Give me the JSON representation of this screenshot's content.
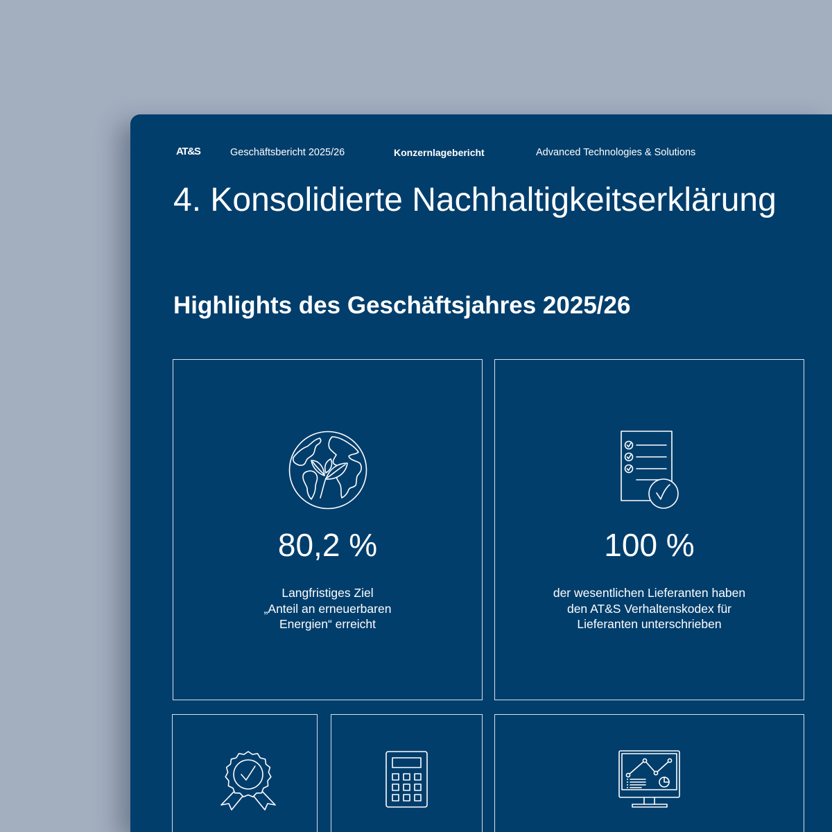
{
  "colors": {
    "background": "#a3aebf",
    "panel": "#023e6c",
    "text": "#ffffff"
  },
  "header": {
    "logo": "AT&S",
    "report": "Geschäftsbericht 2025/26",
    "section": "Konzernlagebericht",
    "company": "Advanced Technologies & Solutions"
  },
  "page": {
    "title": "4. Konsolidierte Nachhaltigkeitserklärung",
    "subtitle": "Highlights des Geschäftsjahres 2025/26"
  },
  "highlights": [
    {
      "icon": "globe-leaf-icon",
      "value": "80,2 %",
      "lines": [
        "Langfristiges Ziel",
        "„Anteil an erneuerbaren",
        "Energien“ erreicht"
      ]
    },
    {
      "icon": "checklist-icon",
      "value": "100 %",
      "lines": [
        "der wesentlichen Lieferanten haben",
        "den AT&S Verhaltenskodex für",
        "Lieferanten unterschrieben"
      ]
    },
    {
      "icon": "award-icon"
    },
    {
      "icon": "calculator-icon"
    },
    {
      "icon": "monitor-chart-icon"
    }
  ]
}
